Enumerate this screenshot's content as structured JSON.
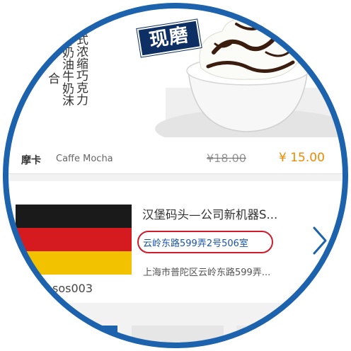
{
  "product": {
    "badge": "现磨",
    "calligraphy": [
      "意式浓缩巧克力",
      "鲜奶油牛奶沫",
      "合"
    ],
    "name_cn": "摩卡",
    "name_en": "Caffe Mocha",
    "original_price": "¥18.00",
    "price": "¥ 15.00"
  },
  "machine": {
    "title": "汉堡码头—公司新机器S...",
    "address": "云岭东路599弄2号506室",
    "full_address": "上海市普陀区云岭东路599弄...",
    "code": "sos003",
    "flag_colors": [
      "#1a1a1a",
      "#d51b20",
      "#f2c100"
    ]
  },
  "colors": {
    "ring": "#1d62ad",
    "price": "#f08a00",
    "highlight": "#d11a2a",
    "address": "#1a55a6"
  },
  "icons": {
    "chevron": "chevron-right-icon"
  }
}
